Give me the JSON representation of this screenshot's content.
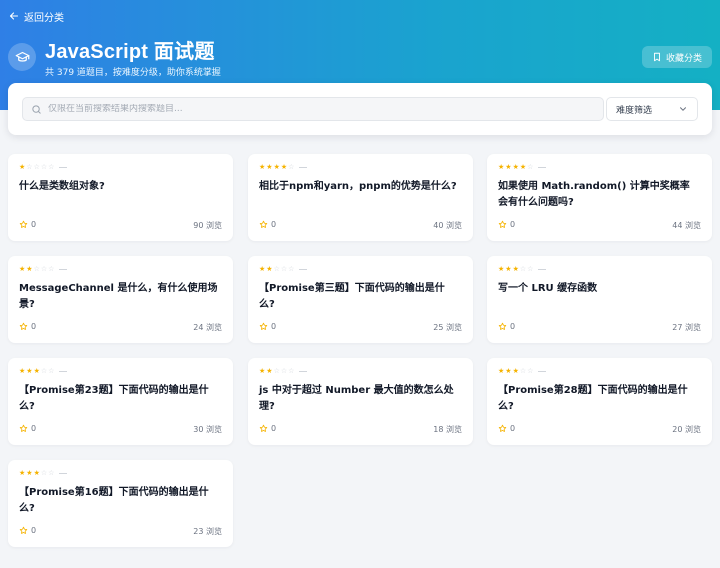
{
  "nav": {
    "back_label": "返回分类"
  },
  "header": {
    "title": "JavaScript 面试题",
    "subtitle": "共 379 道题目，按难度分级，助你系统掌握",
    "favorite_label": "收藏分类"
  },
  "filters": {
    "search_placeholder": "仅限在当前搜索结果内搜索题目...",
    "difficulty_label": "难度筛选"
  },
  "colors": {
    "header_gradient_start": "#2f7fe6",
    "header_gradient_end": "#14b0c4",
    "star_active": "#f5b301",
    "star_inactive": "#d1d5db"
  },
  "questions": [
    {
      "title": "什么是类数组对象?",
      "difficulty": 1,
      "likes": "0",
      "views": "90 浏览"
    },
    {
      "title": "相比于npm和yarn，pnpm的优势是什么?",
      "difficulty": 4,
      "likes": "0",
      "views": "40 浏览"
    },
    {
      "title": "如果使用 Math.random() 计算中奖概率会有什么问题吗?",
      "difficulty": 4,
      "likes": "0",
      "views": "44 浏览"
    },
    {
      "title": "MessageChannel 是什么，有什么使用场景?",
      "difficulty": 2,
      "likes": "0",
      "views": "24 浏览"
    },
    {
      "title": "【Promise第三题】下面代码的输出是什么?",
      "difficulty": 2,
      "likes": "0",
      "views": "25 浏览"
    },
    {
      "title": "写一个 LRU 缓存函数",
      "difficulty": 3,
      "likes": "0",
      "views": "27 浏览"
    },
    {
      "title": "【Promise第23题】下面代码的输出是什么?",
      "difficulty": 3,
      "likes": "0",
      "views": "30 浏览"
    },
    {
      "title": "js 中对于超过 Number 最大值的数怎么处理?",
      "difficulty": 2,
      "likes": "0",
      "views": "18 浏览"
    },
    {
      "title": "【Promise第28题】下面代码的输出是什么?",
      "difficulty": 3,
      "likes": "0",
      "views": "20 浏览"
    },
    {
      "title": "【Promise第16题】下面代码的输出是什么?",
      "difficulty": 3,
      "likes": "0",
      "views": "23 浏览"
    }
  ]
}
